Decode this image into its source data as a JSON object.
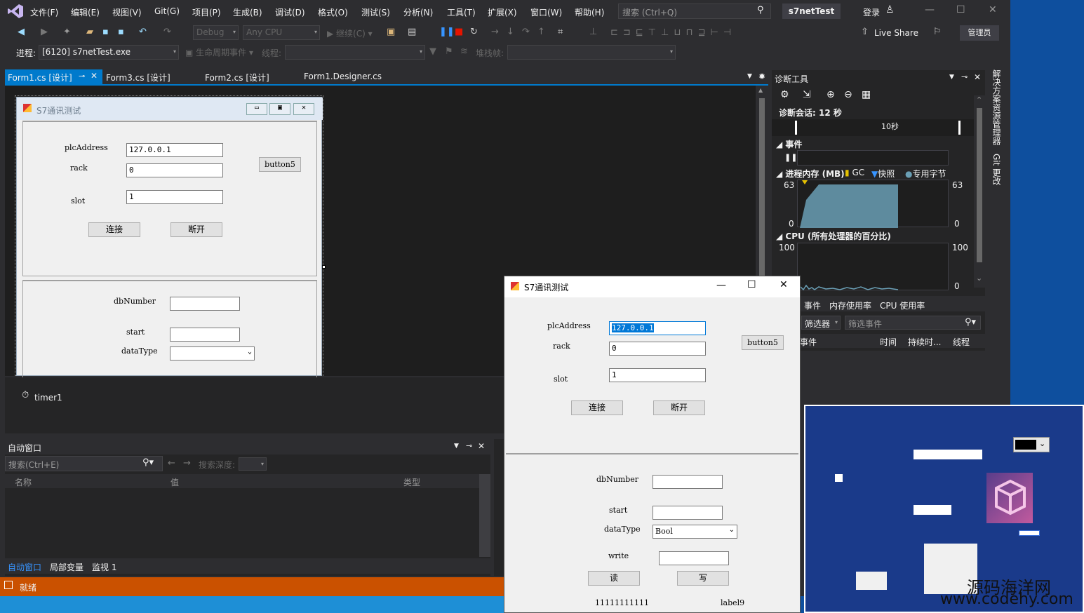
{
  "menubar": {
    "items": [
      "文件(F)",
      "编辑(E)",
      "视图(V)",
      "Git(G)",
      "项目(P)",
      "生成(B)",
      "调试(D)",
      "格式(O)",
      "测试(S)",
      "分析(N)",
      "工具(T)",
      "扩展(X)",
      "窗口(W)",
      "帮助(H)"
    ],
    "search_placeholder": "搜索 (Ctrl+Q)",
    "solution_title": "s7netTest",
    "login_label": "登录"
  },
  "toolbar": {
    "config": "Debug",
    "platform": "Any CPU",
    "continue_label": "继续(C)",
    "live_share": "Live Share",
    "admin_label": "管理员"
  },
  "toolbar2": {
    "process_label": "进程:",
    "process_value": "[6120] s7netTest.exe",
    "lifecycle_label": "生命周期事件",
    "thread_label": "线程:",
    "stackframe_label": "堆栈帧:"
  },
  "tabs": [
    {
      "label": "Form1.cs [设计]"
    },
    {
      "label": "Form3.cs [设计]"
    },
    {
      "label": "Form2.cs [设计]"
    },
    {
      "label": "Form1.Designer.cs"
    }
  ],
  "designer_form": {
    "title": "S7通讯测试",
    "plcAddress_label": "plcAddress",
    "plcAddress_value": "127.0.0.1",
    "rack_label": "rack",
    "rack_value": "0",
    "slot_label": "slot",
    "slot_value": "1",
    "button5": "button5",
    "connect": "连接",
    "disconnect": "断开",
    "dbNumber_label": "dbNumber",
    "start_label": "start",
    "dataType_label": "dataType"
  },
  "component_tray": {
    "timer": "timer1"
  },
  "auto_window": {
    "title": "自动窗口",
    "search_placeholder": "搜索(Ctrl+E)",
    "search_depth": "搜索深度:",
    "columns": [
      "名称",
      "值",
      "类型"
    ],
    "bottom_tabs": [
      "自动窗口",
      "局部变量",
      "监视 1"
    ]
  },
  "status": {
    "text": "就绪"
  },
  "diag": {
    "title": "诊断工具",
    "session": "诊断会话: 12 秒",
    "time_tick": "10秒",
    "events_label": "事件",
    "memory_label": "进程内存 (MB)",
    "gc": "GC",
    "snapshot": "快照",
    "private_bytes": "专用字节",
    "mem_max": "63",
    "mem_min": "0",
    "cpu_label": "CPU (所有处理器的百分比)",
    "cpu_max": "100",
    "cpu_min": "0",
    "tabs": [
      "事件",
      "内存使用率",
      "CPU 使用率"
    ],
    "filter": "筛选器",
    "filter_placeholder": "筛选事件",
    "cols": [
      "事件",
      "时间",
      "持续时...",
      "线程"
    ]
  },
  "side_tabs": [
    "解决方案资源管理器",
    "Git 更改"
  ],
  "runtime_form": {
    "title": "S7通讯测试",
    "plcAddress_label": "plcAddress",
    "plcAddress_value": "127.0.0.1",
    "rack_label": "rack",
    "rack_value": "0",
    "slot_label": "slot",
    "slot_value": "1",
    "button5": "button5",
    "connect": "连接",
    "disconnect": "断开",
    "dbNumber_label": "dbNumber",
    "start_label": "start",
    "dataType_label": "dataType",
    "dataType_value": "Bool",
    "write_label": "write",
    "read_btn": "读",
    "write_btn": "写",
    "result_text": "11111111111",
    "label9": "label9"
  },
  "watermark": {
    "line1": "源码海洋网",
    "line2": "www.codehy.com"
  },
  "colors": {
    "accent": "#007acc",
    "status": "#ca5100",
    "ide_bg": "#2d2d30"
  }
}
